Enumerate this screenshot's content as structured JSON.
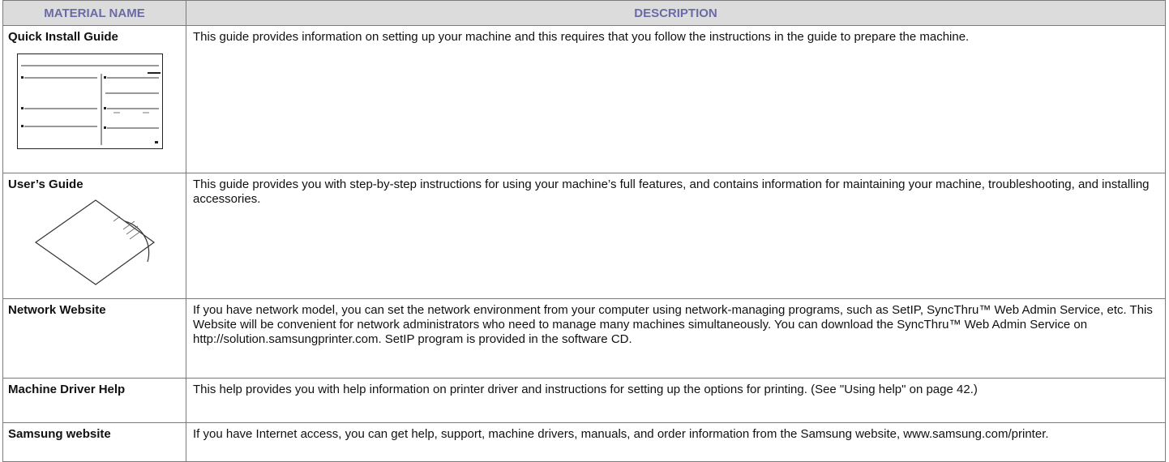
{
  "header": {
    "material_name": "MATERIAL NAME",
    "description": "DESCRIPTION"
  },
  "rows": [
    {
      "name": "Quick Install Guide",
      "description": "This guide provides information on setting up your machine and this requires that you follow the instructions in the guide to prepare the machine.",
      "illustration": "quick-install-guide-thumbnail"
    },
    {
      "name": "User’s Guide",
      "description": "This guide provides you with step-by-step instructions for using your machine’s full features, and contains information for maintaining your machine, troubleshooting, and installing accessories.",
      "illustration": "cd-sleeve-icon"
    },
    {
      "name": "Network Website",
      "description": "If you have network model, you can set the network environment from your computer using network-managing programs, such as SetIP, SyncThru™ Web Admin Service, etc. This Website will be convenient for network administrators who need to manage many machines simultaneously. You can download the SyncThru™ Web Admin Service on http://solution.samsungprinter.com. SetIP program is provided in the software CD."
    },
    {
      "name": "Machine Driver Help",
      "description": "This help provides you with help information on printer driver and instructions for setting up the options for printing. (See \"Using help\" on page 42.)"
    },
    {
      "name": "Samsung website",
      "description": "If you have Internet access, you can get help, support, machine drivers, manuals, and order information from the Samsung website, www.samsung.com/printer."
    }
  ]
}
